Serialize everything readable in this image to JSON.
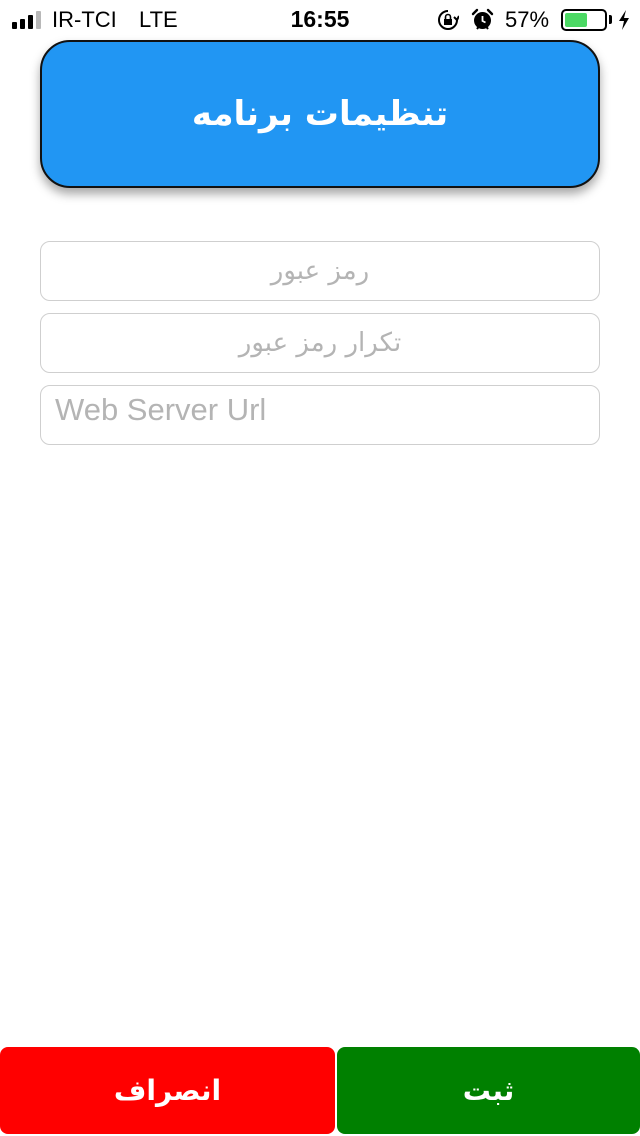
{
  "status_bar": {
    "carrier": "IR-TCI",
    "network": "LTE",
    "time": "16:55",
    "battery_percent": "57%",
    "battery_level": 0.57,
    "battery_color": "#4cd964",
    "icons": [
      "signal-icon",
      "rotation-lock-icon",
      "alarm-icon",
      "battery-icon",
      "charging-icon"
    ]
  },
  "header": {
    "title": "تنظیمات برنامه",
    "background": "#2196f3"
  },
  "form": {
    "password_placeholder": "رمز عبور",
    "password_value": "",
    "confirm_placeholder": "تکرار رمز عبور",
    "confirm_value": "",
    "url_placeholder": "Web Server Url",
    "url_value": ""
  },
  "buttons": {
    "cancel_label": "انصراف",
    "cancel_color": "#ff0000",
    "submit_label": "ثبت",
    "submit_color": "#008000"
  }
}
